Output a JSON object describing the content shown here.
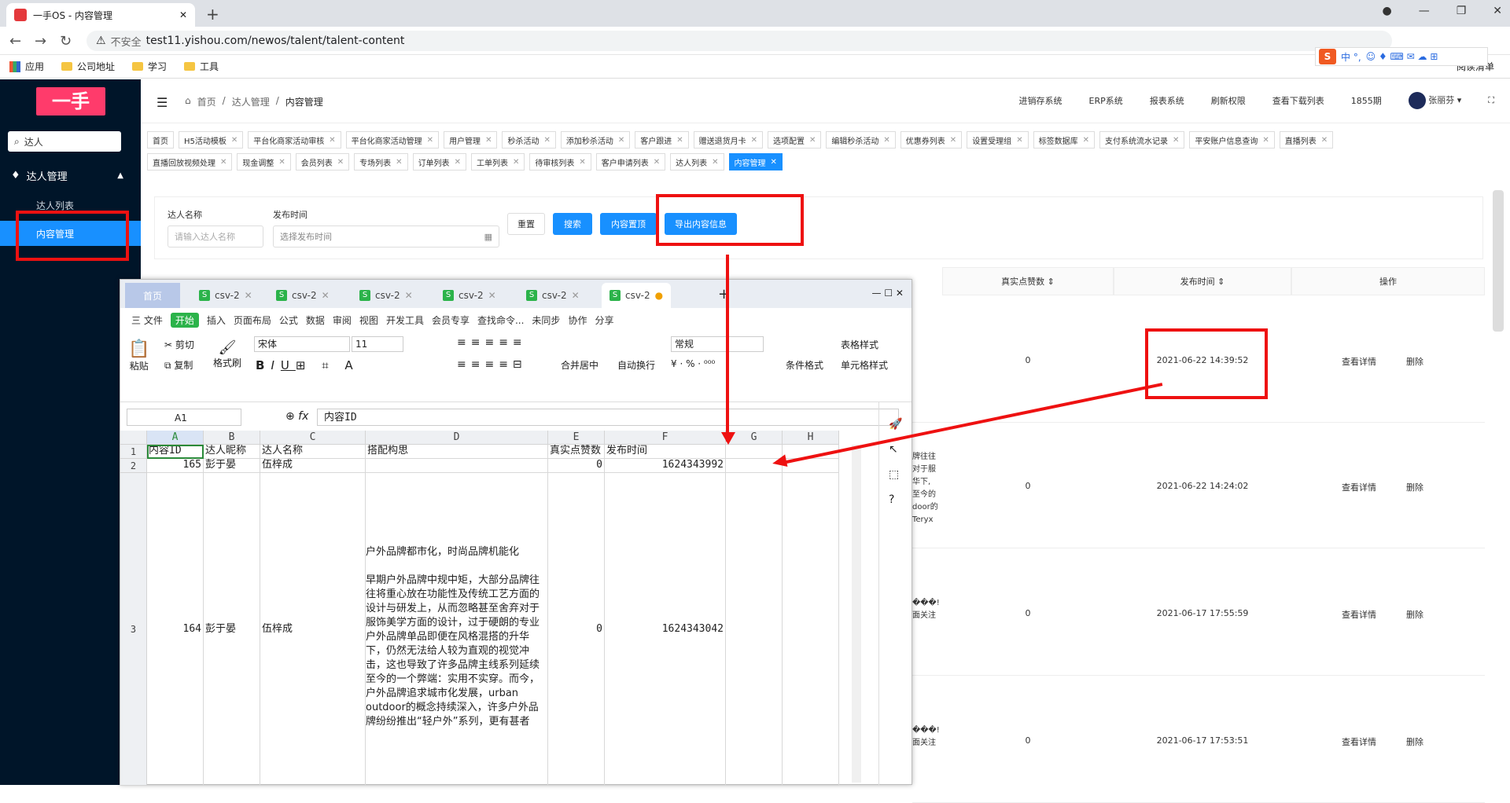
{
  "browser": {
    "tab_title": "一手OS - 内容管理",
    "security": "不安全",
    "url": "test11.yishou.com/newos/talent/talent-content",
    "bookmarks": [
      "应用",
      "公司地址",
      "学习",
      "工具"
    ],
    "reading_list": "阅读清单",
    "ime": "中 °,"
  },
  "app": {
    "logo": "一手",
    "search_value": "达人",
    "menu_group": "达人管理",
    "menu_items": [
      "达人列表",
      "内容管理"
    ],
    "breadcrumb": [
      "首页",
      "达人管理",
      "内容管理"
    ],
    "header_nav": [
      "进销存系统",
      "ERP系统",
      "报表系统",
      "刷新权限",
      "查看下载列表",
      "1855期",
      "张丽芬"
    ],
    "tags_row1": [
      "首页",
      "H5活动模板",
      "平台化商家活动审核",
      "平台化商家活动管理",
      "用户管理",
      "秒杀活动",
      "添加秒杀活动",
      "客户跟进",
      "赠送退货月卡",
      "选项配置",
      "编辑秒杀活动",
      "优惠券列表",
      "设置受理组",
      "标签数据库",
      "支付系统流水记录",
      "平安账户信息查询",
      "直播列表"
    ],
    "tags_row2": [
      "直播回放视频处理",
      "现金调整",
      "会员列表",
      "专场列表",
      "订单列表",
      "工单列表",
      "待审核列表",
      "客户申请列表",
      "达人列表",
      "内容管理"
    ],
    "filter": {
      "name_label": "达人名称",
      "name_placeholder": "请输入达人名称",
      "time_label": "发布时间",
      "time_placeholder": "选择发布时间",
      "btn_reset": "重置",
      "btn_search": "搜索",
      "btn_top": "内容置顶",
      "btn_export": "导出内容信息"
    },
    "table": {
      "headers": [
        "真实点赞数",
        "发布时间",
        "操作"
      ],
      "rows": [
        {
          "likes": "0",
          "time": "2021-06-22 14:39:52",
          "view": "查看详情",
          "del": "删除",
          "snip": ""
        },
        {
          "likes": "0",
          "time": "2021-06-22 14:24:02",
          "view": "查看详情",
          "del": "删除",
          "snip": "牌往往\n对于服\n华下,\n至今的\ndoor的\nTeryx"
        },
        {
          "likes": "0",
          "time": "2021-06-17 17:55:59",
          "view": "查看详情",
          "del": "删除",
          "snip": "���!\n面关注"
        },
        {
          "likes": "0",
          "time": "2021-06-17 17:53:51",
          "view": "查看详情",
          "del": "删除",
          "snip": "���!\n面关注"
        }
      ]
    }
  },
  "wps": {
    "tabs": [
      "首页",
      "csv-2",
      "csv-2",
      "csv-2",
      "csv-2",
      "csv-2",
      "csv-2"
    ],
    "menu": [
      "三 文件",
      "开始",
      "插入",
      "页面布局",
      "公式",
      "数据",
      "审阅",
      "视图",
      "开发工具",
      "会员专享",
      "查找命令...",
      "未同步",
      "协作",
      "分享"
    ],
    "ribbon": {
      "paste": "粘贴",
      "cut": "剪切",
      "copy": "复制",
      "format_painter": "格式刷",
      "font": "宋体",
      "size": "11",
      "merge": "合并居中",
      "wrap": "自动换行",
      "number_format": "常规",
      "cond_format": "条件格式",
      "table_style": "表格样式",
      "cell_style": "单元格样式"
    },
    "namebox": "A1",
    "formula": "内容ID",
    "columns": [
      "A",
      "B",
      "C",
      "D",
      "E",
      "F",
      "G",
      "H"
    ],
    "rows": [
      {
        "n": "1",
        "a": "内容ID",
        "b": "达人昵称",
        "c": "达人名称",
        "d": "搭配构思",
        "e": "真实点赞数",
        "f": "发布时间"
      },
      {
        "n": "2",
        "a": "165",
        "b": "彭于晏",
        "c": "伍梓成",
        "d": "",
        "e": "0",
        "f": "1624343992"
      },
      {
        "n": "3",
        "a": "164",
        "b": "彭于晏",
        "c": "伍梓成",
        "e": "0",
        "f": "1624343042"
      }
    ],
    "long_text": "户外品牌都市化，时尚品牌机能化\n\n早期户外品牌中规中矩，大部分品牌往往将重心放在功能性及传统工艺方面的设计与研发上，从而忽略甚至舍弃对于服饰美学方面的设计，过于硬朗的专业户外品牌单品即便在风格混搭的升华下，仍然无法给人较为直观的视觉冲击，这也导致了许多品牌主线系列延续至今的一个弊端：实用不实穿。而今，户外品牌追求城市化发展，urban outdoor的概念持续深入，许多户外品牌纷纷推出“轻户外”系列，更有甚者"
  },
  "colors": {
    "accent": "#1890ff",
    "sidebar": "#001529",
    "logo": "#ff3b6b",
    "annot": "#e11111"
  }
}
